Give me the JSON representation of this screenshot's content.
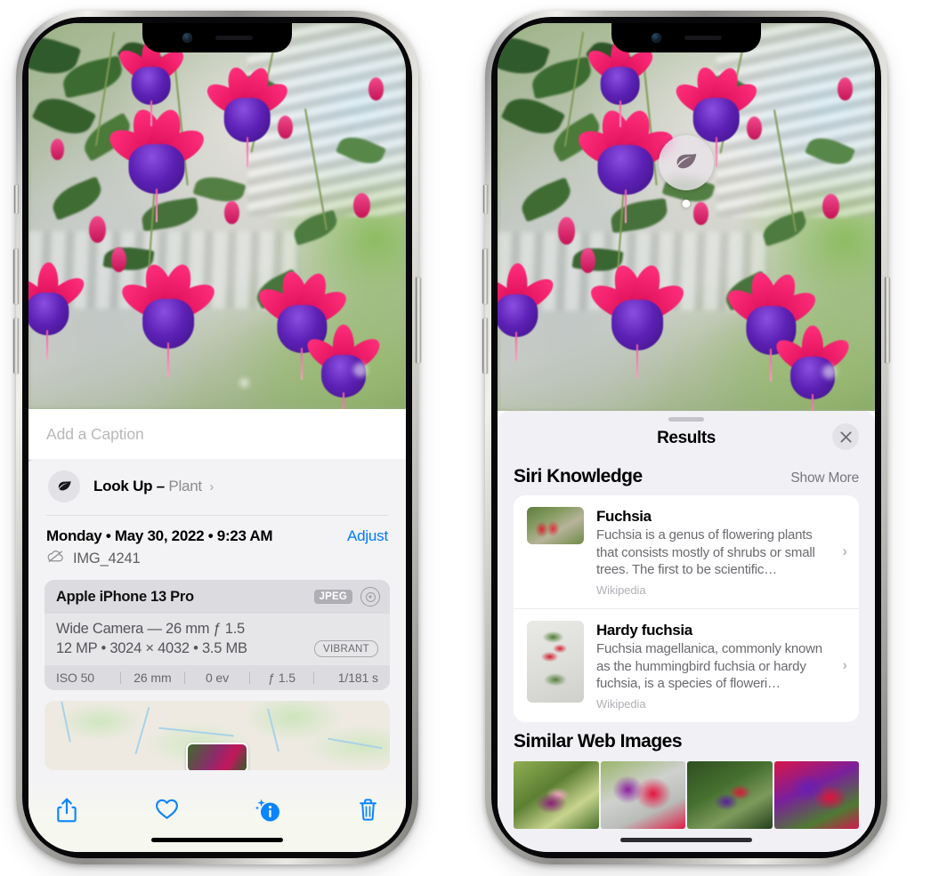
{
  "left_phone": {
    "photo": {
      "alt": "fuchsia-flowers-hanging-basket"
    },
    "caption": {
      "placeholder": "Add a Caption",
      "value": ""
    },
    "lookup": {
      "icon": "leaf-icon",
      "label": "Look Up –",
      "subject": "Plant",
      "chevron": "›"
    },
    "date": {
      "text": "Monday • May 30, 2022 • 9:23 AM",
      "adjust_label": "Adjust",
      "filename": "IMG_4241",
      "cloud_icon": "icloud-slash-icon"
    },
    "metadata": {
      "device": "Apple iPhone 13 Pro",
      "format_badge": "JPEG",
      "lens_icon": "aperture-icon",
      "lens_line": "Wide Camera — 26 mm ƒ 1.5",
      "spec_line": "12 MP • 3024 × 4032 • 3.5 MB",
      "style_badge": "VIBRANT",
      "exif": [
        "ISO 50",
        "26 mm",
        "0 ev",
        "ƒ 1.5",
        "1/181 s"
      ]
    },
    "map": {
      "alt": "location-map-with-photo-pin"
    },
    "toolbar": [
      {
        "name": "share-icon",
        "label": "Share"
      },
      {
        "name": "heart-icon",
        "label": "Favorite"
      },
      {
        "name": "info-sparkle-icon",
        "label": "Info"
      },
      {
        "name": "trash-icon",
        "label": "Delete"
      }
    ]
  },
  "right_phone": {
    "photo": {
      "alt": "fuchsia-flowers-hanging-basket"
    },
    "visual_lookup_badge": {
      "icon": "leaf-icon"
    },
    "sheet": {
      "title": "Results",
      "close_label": "×",
      "sections": [
        {
          "title": "Siri Knowledge",
          "action": "Show More",
          "items": [
            {
              "title": "Fuchsia",
              "description": "Fuchsia is a genus of flowering plants that consists mostly of shrubs or small trees. The first to be scientific…",
              "source": "Wikipedia",
              "chevron": "›"
            },
            {
              "title": "Hardy fuchsia",
              "description": "Fuchsia magellanica, commonly known as the hummingbird fuchsia or hardy fuchsia, is a species of floweri…",
              "source": "Wikipedia",
              "chevron": "›"
            }
          ]
        },
        {
          "title": "Similar Web Images",
          "action": "",
          "thumbnails": [
            {
              "alt": "fuchsia-web-image-1"
            },
            {
              "alt": "fuchsia-web-image-2"
            },
            {
              "alt": "fuchsia-web-image-3"
            },
            {
              "alt": "fuchsia-web-image-4"
            }
          ]
        }
      ]
    }
  },
  "colors": {
    "accent_blue": "#007aff",
    "toolbar_blue": "#0a84ff",
    "sheet_bg": "#f1f0f5",
    "card_bg": "#ffffff",
    "meta_card": "#e6e6e9"
  }
}
